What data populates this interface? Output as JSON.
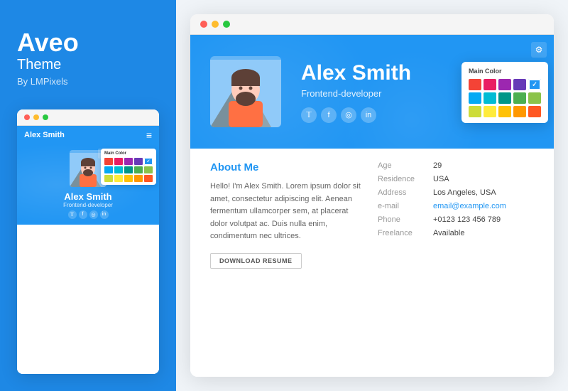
{
  "brand": {
    "title": "Aveo",
    "subtitle": "Theme",
    "by": "By LMPixels"
  },
  "mini_browser": {
    "nav": {
      "name": "Alex Smith",
      "hamburger": "≡"
    },
    "hero": {
      "name": "Alex Smith",
      "role": "Frontend-developer"
    },
    "color_picker": {
      "title": "Main Color",
      "colors": [
        "#F44336",
        "#E91E63",
        "#9C27B0",
        "#673AB7",
        "#2196F3",
        "#03A9F4",
        "#00BCD4",
        "#009688",
        "#4CAF50",
        "#8BC34A",
        "#CDDC39",
        "#FFEB3B",
        "#FFC107",
        "#FF9800",
        "#FF5722"
      ],
      "selected_index": 4
    }
  },
  "big_browser": {
    "hero": {
      "name": "Alex Smith",
      "role": "Frontend-developer",
      "gear_label": "⚙"
    },
    "color_picker": {
      "title": "Main Color",
      "colors": [
        "#F44336",
        "#E91E63",
        "#9C27B0",
        "#673AB7",
        "#2196F3",
        "#03A9F4",
        "#00BCD4",
        "#009688",
        "#4CAF50",
        "#8BC34A",
        "#CDDC39",
        "#FFEB3B",
        "#FFC107",
        "#FF9800",
        "#FF5722"
      ],
      "selected_index": 4
    },
    "social": [
      "𝕋",
      "f",
      "◎",
      "in"
    ],
    "about": {
      "title_plain": "About",
      "title_accent": "Me",
      "text": "Hello! I'm Alex Smith. Lorem ipsum dolor sit amet, consectetur adipiscing elit. Aenean fermentum ullamcorper sem, at placerat dolor volutpat ac. Duis nulla enim, condimentum nec ultrices.",
      "download_btn": "DOWNLOAD RESUME"
    },
    "info": [
      {
        "label": "Age",
        "value": "29",
        "link": false
      },
      {
        "label": "Residence",
        "value": "USA",
        "link": false
      },
      {
        "label": "Address",
        "value": "Los Angeles, USA",
        "link": false
      },
      {
        "label": "e-mail",
        "value": "email@example.com",
        "link": true
      },
      {
        "label": "Phone",
        "value": "+0123 123 456 789",
        "link": false
      },
      {
        "label": "Freelance",
        "value": "Available",
        "link": false
      }
    ]
  },
  "colors": {
    "palette": [
      "#F44336",
      "#E91E63",
      "#9C27B0",
      "#673AB7",
      "#2196F3",
      "#03A9F4",
      "#00BCD4",
      "#009688",
      "#4CAF50",
      "#8BC34A",
      "#CDDC39",
      "#FFEB3B",
      "#FFC107",
      "#FF9800",
      "#FF5722"
    ]
  }
}
